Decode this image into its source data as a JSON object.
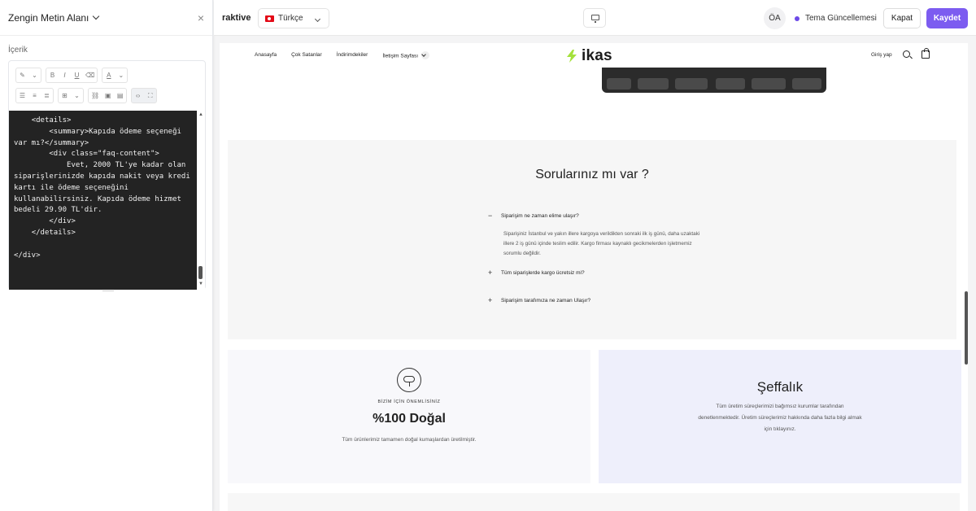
{
  "left_panel": {
    "title": "Zengin Metin Alanı",
    "close_icon": "×",
    "section_label": "İçerik",
    "code_lines": [
      "    <details>",
      "        <summary>Kapıda ödeme seçeneği var mı?</summary>",
      "        <div class=\"faq-content\">",
      "            Evet, 2000 TL'ye kadar olan siparişlerinizde kapıda nakit veya kredi kartı ile ödeme seçeneğini kullanabilirsiniz. Kapıda ödeme hizmet bedeli 29.90 TL'dir.",
      "        </div>",
      "    </details>",
      "",
      "</div>"
    ]
  },
  "toolbar": {
    "bold": "B",
    "italic": "I",
    "underline": "U",
    "text_color": "A"
  },
  "topbar": {
    "store_name": "raktive",
    "language": "Türkçe",
    "avatar_initials": "ÖA",
    "theme_status": "Tema Güncellemesi",
    "close_label": "Kapat",
    "save_label": "Kaydet",
    "accent_color": "#7c5cf0"
  },
  "site": {
    "nav": [
      "Anasayfa",
      "Çok Satanlar",
      "İndirimdekiler",
      "İletişim Sayfası"
    ],
    "logo_text": "ikas",
    "login": "Giriş yap",
    "faq_title": "Sorularınız mı var ?",
    "faq": [
      {
        "question": "Siparişim ne zaman elime ulaşır?",
        "expanded": true,
        "answer": "Siparişiniz İstanbul ve yakın illere kargoya verildikten sonraki ilk iş günü, daha uzaktaki illere 2 iş günü içinde teslim edilir. Kargo firması kaynaklı gecikmelerden işletmemiz sorumlu değildir."
      },
      {
        "question": "Tüm siparişlerde kargo ücretsiz mi?",
        "expanded": false
      },
      {
        "question": "Siparişim tarafımıza ne zaman Ulaşır?",
        "expanded": false
      }
    ],
    "feature1": {
      "eyebrow": "BİZİM İÇİN ÖNEMLİSİNİZ",
      "title": "%100 Doğal",
      "desc": "Tüm ürünlerimiz tamamen doğal kumaşlardan üretilmiştir."
    },
    "feature2": {
      "title": "Şeffalık",
      "desc": "Tüm üretim süreçlerimizi bağımsız kurumlar tarafından denetlenmektedir. Üretim süreçlerimiz hakkında daha fazla bilgi almak için tıklayınız."
    }
  }
}
